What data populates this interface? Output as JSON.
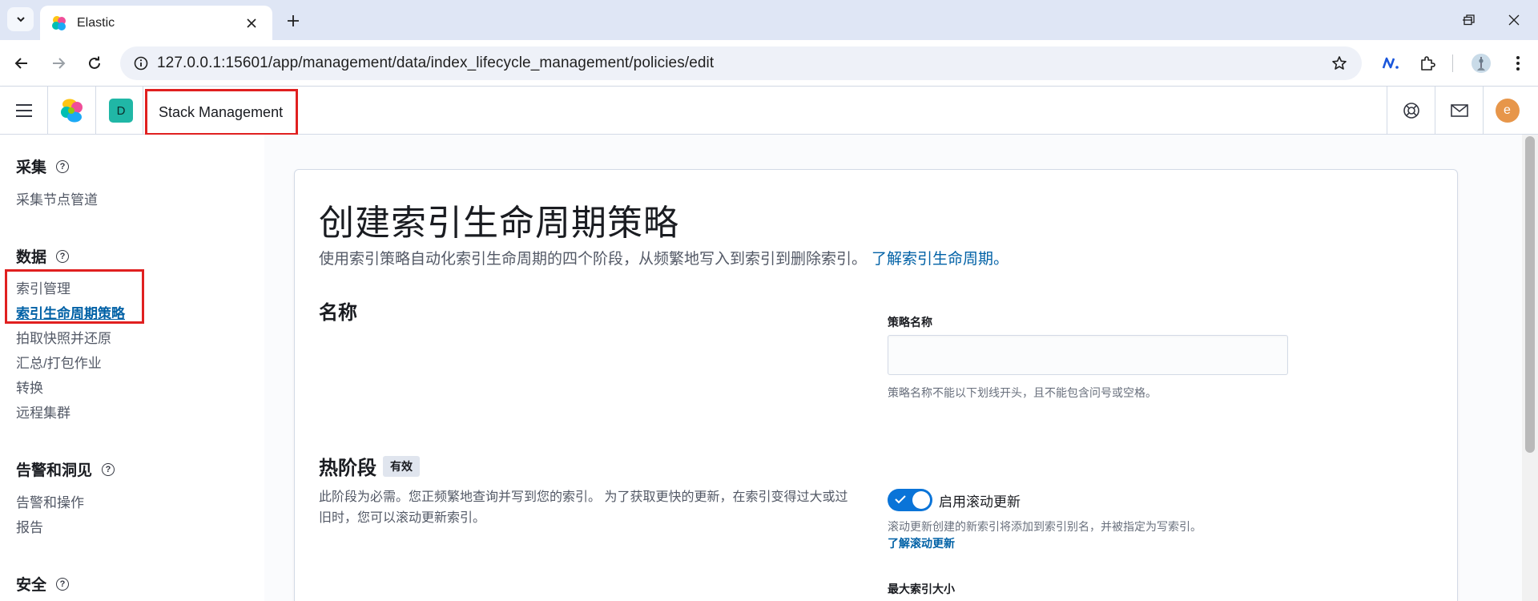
{
  "browser": {
    "tab_title": "Elastic",
    "url": "127.0.0.1:15601/app/management/data/index_lifecycle_management/policies/edit"
  },
  "header": {
    "space_initial": "D",
    "breadcrumb": "Stack Management",
    "user_initial": "e"
  },
  "sidenav": {
    "groups": [
      {
        "title": "采集",
        "items": [
          "采集节点管道"
        ]
      },
      {
        "title": "数据",
        "items": [
          "索引管理",
          "索引生命周期策略",
          "拍取快照并还原",
          "汇总/打包作业",
          "转换",
          "远程集群"
        ]
      },
      {
        "title": "告警和洞见",
        "items": [
          "告警和操作",
          "报告"
        ]
      },
      {
        "title": "安全",
        "items": []
      }
    ],
    "active_item": "索引生命周期策略"
  },
  "main": {
    "title": "创建索引生命周期策略",
    "description": "使用索引策略自动化索引生命周期的四个阶段，从频繁地写入到索引到删除索引。",
    "learn_more": "了解索引生命周期。",
    "name_section": {
      "title": "名称",
      "field_label": "策略名称",
      "field_value": "",
      "field_help": "策略名称不能以下划线开头，且不能包含问号或空格。"
    },
    "hot_phase": {
      "title": "热阶段",
      "badge": "有效",
      "description": "此阶段为必需。您正频繁地查询并写到您的索引。 为了获取更快的更新，在索引变得过大或过旧时，您可以滚动更新索引。",
      "rollover_label": "启用滚动更新",
      "rollover_enabled": true,
      "rollover_help": "滚动更新创建的新索引将添加到索引别名，并被指定为写索引。",
      "rollover_link": "了解滚动更新",
      "max_size_label": "最大索引大小"
    }
  },
  "colors": {
    "accent": "#0061a6",
    "switch_on": "#0a74d8",
    "highlight": "#e02020",
    "space_badge": "#20b7a6",
    "avatar": "#e7964a"
  }
}
